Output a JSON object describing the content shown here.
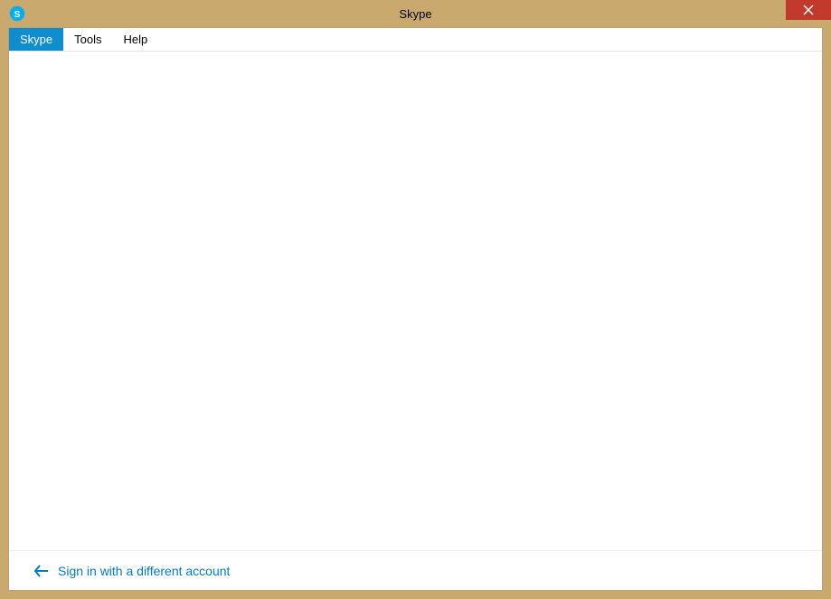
{
  "window": {
    "title": "Skype"
  },
  "menubar": {
    "items": [
      {
        "label": "Skype",
        "active": true
      },
      {
        "label": "Tools",
        "active": false
      },
      {
        "label": "Help",
        "active": false
      }
    ]
  },
  "footer": {
    "link_label": "Sign in with a different account"
  }
}
